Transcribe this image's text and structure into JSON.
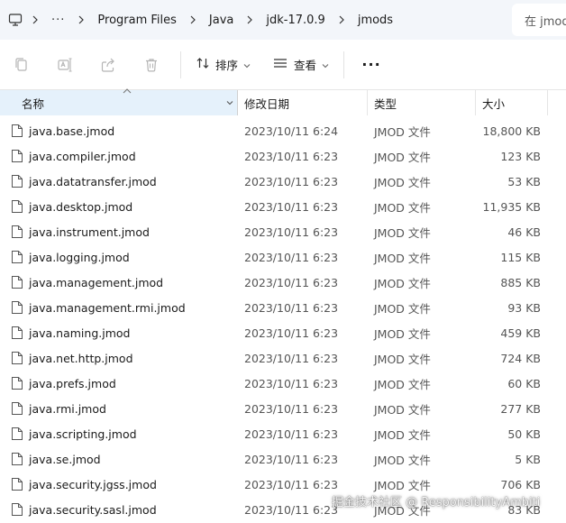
{
  "address": {
    "computer_icon": "computer-icon",
    "overflow_label": "···",
    "crumbs": [
      "Program Files",
      "Java",
      "jdk-17.0.9",
      "jmods"
    ],
    "search_placeholder": "在 jmods"
  },
  "toolbar": {
    "icons": [
      "copy-icon",
      "rename-icon",
      "share-icon",
      "delete-icon"
    ],
    "sort_label": "排序",
    "view_label": "查看",
    "more_label": "···"
  },
  "columns": {
    "name": "名称",
    "date": "修改日期",
    "type": "类型",
    "size": "大小"
  },
  "files": [
    {
      "name": "java.base.jmod",
      "date": "2023/10/11 6:24",
      "type": "JMOD 文件",
      "size": "18,800 KB"
    },
    {
      "name": "java.compiler.jmod",
      "date": "2023/10/11 6:23",
      "type": "JMOD 文件",
      "size": "123 KB"
    },
    {
      "name": "java.datatransfer.jmod",
      "date": "2023/10/11 6:23",
      "type": "JMOD 文件",
      "size": "53 KB"
    },
    {
      "name": "java.desktop.jmod",
      "date": "2023/10/11 6:23",
      "type": "JMOD 文件",
      "size": "11,935 KB"
    },
    {
      "name": "java.instrument.jmod",
      "date": "2023/10/11 6:23",
      "type": "JMOD 文件",
      "size": "46 KB"
    },
    {
      "name": "java.logging.jmod",
      "date": "2023/10/11 6:23",
      "type": "JMOD 文件",
      "size": "115 KB"
    },
    {
      "name": "java.management.jmod",
      "date": "2023/10/11 6:23",
      "type": "JMOD 文件",
      "size": "885 KB"
    },
    {
      "name": "java.management.rmi.jmod",
      "date": "2023/10/11 6:23",
      "type": "JMOD 文件",
      "size": "93 KB"
    },
    {
      "name": "java.naming.jmod",
      "date": "2023/10/11 6:23",
      "type": "JMOD 文件",
      "size": "459 KB"
    },
    {
      "name": "java.net.http.jmod",
      "date": "2023/10/11 6:23",
      "type": "JMOD 文件",
      "size": "724 KB"
    },
    {
      "name": "java.prefs.jmod",
      "date": "2023/10/11 6:23",
      "type": "JMOD 文件",
      "size": "60 KB"
    },
    {
      "name": "java.rmi.jmod",
      "date": "2023/10/11 6:23",
      "type": "JMOD 文件",
      "size": "277 KB"
    },
    {
      "name": "java.scripting.jmod",
      "date": "2023/10/11 6:23",
      "type": "JMOD 文件",
      "size": "50 KB"
    },
    {
      "name": "java.se.jmod",
      "date": "2023/10/11 6:23",
      "type": "JMOD 文件",
      "size": "5 KB"
    },
    {
      "name": "java.security.jgss.jmod",
      "date": "2023/10/11 6:23",
      "type": "JMOD 文件",
      "size": "706 KB"
    },
    {
      "name": "java.security.sasl.jmod",
      "date": "2023/10/11 6:23",
      "type": "JMOD 文件",
      "size": "83 KB"
    }
  ],
  "watermark": "掘金技术社区 @ ResponsibilityAmbiti",
  "colors": {
    "header_selected": "#e5f1fb",
    "address_bg": "#f3f6fa"
  }
}
